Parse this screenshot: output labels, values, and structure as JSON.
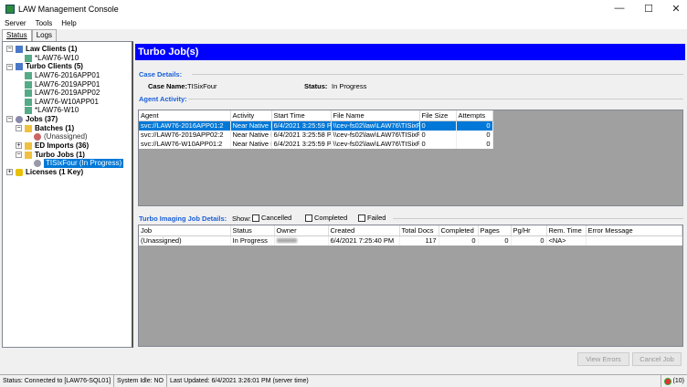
{
  "window": {
    "title": "LAW Management Console",
    "minimize": "—",
    "maximize": "☐",
    "close": "✕"
  },
  "menu": [
    "Server",
    "Tools",
    "Help"
  ],
  "tabs": [
    {
      "label": "Status",
      "active": true
    },
    {
      "label": "Logs",
      "active": false
    }
  ],
  "tree": {
    "law_clients": "Law Clients (1)",
    "law_client_items": [
      "*LAW76-W10"
    ],
    "turbo_clients": "Turbo Clients (5)",
    "turbo_client_items": [
      "LAW76-2016APP01",
      "LAW76-2019APP01",
      "LAW76-2019APP02",
      "LAW76-W10APP01",
      "*LAW76-W10"
    ],
    "jobs": "Jobs (37)",
    "batches": "Batches (1)",
    "batches_item": "(Unassigned)",
    "ed_imports": "ED Imports (36)",
    "turbo_jobs": "Turbo Jobs (1)",
    "turbo_jobs_item": "TISixFour (In Progress)",
    "licenses": "Licenses (1 Key)"
  },
  "panel": {
    "title": "Turbo Job(s)",
    "case_details_label": "Case Details:",
    "case_name_label": "Case Name:",
    "case_name": "TISixFour",
    "status_label": "Status:",
    "status": "In Progress",
    "agent_activity_label": "Agent Activity:"
  },
  "agent_table": {
    "columns": [
      "Agent",
      "Activity",
      "Start Time",
      "File Name",
      "File Size",
      "Attempts"
    ],
    "rows": [
      [
        "svc://LAW76-2016APP01:2",
        "Near Native I",
        "6/4/2021 3:25:59 PM",
        "\\\\cev-fs02\\law\\LAW76\\TISixF",
        "0",
        "0"
      ],
      [
        "svc://LAW76-2019APP02:2",
        "Near Native I",
        "6/4/2021 3:25:58 PM",
        "\\\\cev-fs02\\law\\LAW76\\TISixF",
        "0",
        "0"
      ],
      [
        "svc://LAW76-W10APP01:2",
        "Near Native I",
        "6/4/2021 3:25:59 PM",
        "\\\\cev-fs02\\law\\LAW76\\TISixF",
        "0",
        "0"
      ]
    ],
    "selected_row": 0
  },
  "job_details": {
    "label": "Turbo Imaging Job Details:",
    "show_label": "Show:",
    "filters": [
      {
        "label": "Cancelled",
        "checked": false
      },
      {
        "label": "Completed",
        "checked": false
      },
      {
        "label": "Failed",
        "checked": false
      }
    ]
  },
  "job_table": {
    "columns": [
      "Job",
      "Status",
      "Owner",
      "Created",
      "Total Docs",
      "Completed",
      "Pages",
      "Pg/Hr",
      "Rem. Time",
      "Error Message"
    ],
    "rows": [
      [
        "(Unassigned)",
        "In Progress",
        "",
        "6/4/2021 7:25:40 PM",
        "117",
        "0",
        "0",
        "0",
        "<NA>",
        ""
      ]
    ]
  },
  "buttons": {
    "view_errors": "View Errors",
    "cancel_job": "Cancel Job"
  },
  "statusbar": {
    "connection": "Status: Connected to [LAW76-SQL01]",
    "idle": "System Idle: NO",
    "updated": "Last Updated: 6/4/2021 3:26:01 PM (server time)",
    "count": "(10)"
  },
  "colors": {
    "header": "#0000ff",
    "selection": "#0078d7",
    "section_label": "#1a5fd6"
  }
}
